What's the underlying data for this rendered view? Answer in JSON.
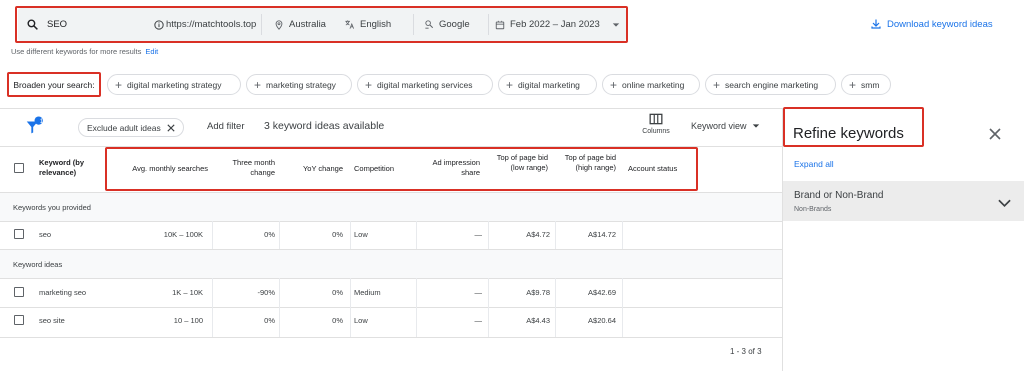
{
  "search": {
    "query": "SEO",
    "site": "https://matchtools.top",
    "location": "Australia",
    "language": "English",
    "engine": "Google",
    "date_range": "Feb 2022 – Jan 2023",
    "hint": "Use different keywords for more results",
    "edit_label": "Edit"
  },
  "download_label": "Download keyword ideas",
  "broaden": {
    "label": "Broaden your search:",
    "chips": [
      "digital marketing strategy",
      "marketing strategy",
      "digital marketing services",
      "digital marketing",
      "online marketing",
      "search engine marketing",
      "smm"
    ]
  },
  "toolbar": {
    "filter_badge": "1",
    "exclude_chip": "Exclude adult ideas",
    "add_filter": "Add filter",
    "ideas_available": "3 keyword ideas available",
    "columns_label": "Columns",
    "keyword_view": "Keyword view"
  },
  "table": {
    "headers": [
      "Keyword (by relevance)",
      "Avg. monthly searches",
      "Three month change",
      "YoY change",
      "Competition",
      "Ad impression share",
      "Top of page bid (low range)",
      "Top of page bid (high range)",
      "Account status"
    ],
    "section_provided": "Keywords you provided",
    "section_ideas": "Keyword ideas",
    "rows": [
      [
        "seo",
        "10K – 100K",
        "0%",
        "0%",
        "Low",
        "—",
        "A$4.72",
        "A$14.72"
      ],
      [
        "marketing seo",
        "1K – 10K",
        "-90%",
        "0%",
        "Medium",
        "—",
        "A$9.78",
        "A$42.69"
      ],
      [
        "seo site",
        "10 – 100",
        "0%",
        "0%",
        "Low",
        "—",
        "A$4.43",
        "A$20.64"
      ]
    ],
    "pagination": "1 - 3 of 3"
  },
  "refine": {
    "title": "Refine keywords",
    "expand_all": "Expand all",
    "group_title": "Brand or Non-Brand",
    "group_sub": "Non-Brands"
  },
  "colors": {
    "highlight": "#d93025",
    "link": "#1a73e8",
    "search_bg": "#f1f3f4",
    "section_bg": "#f8f9fa",
    "panel_group_bg": "#ececec"
  }
}
